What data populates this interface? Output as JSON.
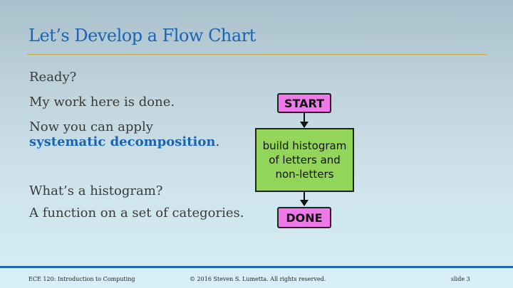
{
  "slide": {
    "title": "Let’s Develop a Flow Chart",
    "lines": {
      "ready": "Ready?",
      "done": "My work here is done.",
      "apply": "Now you can apply",
      "decomp": "systematic decomposition",
      "period": ".",
      "histogram_q": "What’s a histogram?",
      "function_def": "A function on a set of categories."
    },
    "flowchart": {
      "start": "START",
      "process_line1": "build histogram",
      "process_line2": "of letters and",
      "process_line3": "non-letters",
      "done": "DONE"
    }
  },
  "footer": {
    "course": "ECE 120: Introduction to Computing",
    "copyright": "© 2016 Steven S. Lumetta.  All rights reserved.",
    "slide_number": "slide 3"
  },
  "colors": {
    "title": "#1a64b0",
    "emphasis": "#1a64b0",
    "terminal_fill": "#ef79e8",
    "process_fill": "#93d45a",
    "footer_bar": "#1f67b4",
    "title_rule": "#b8a84a"
  }
}
